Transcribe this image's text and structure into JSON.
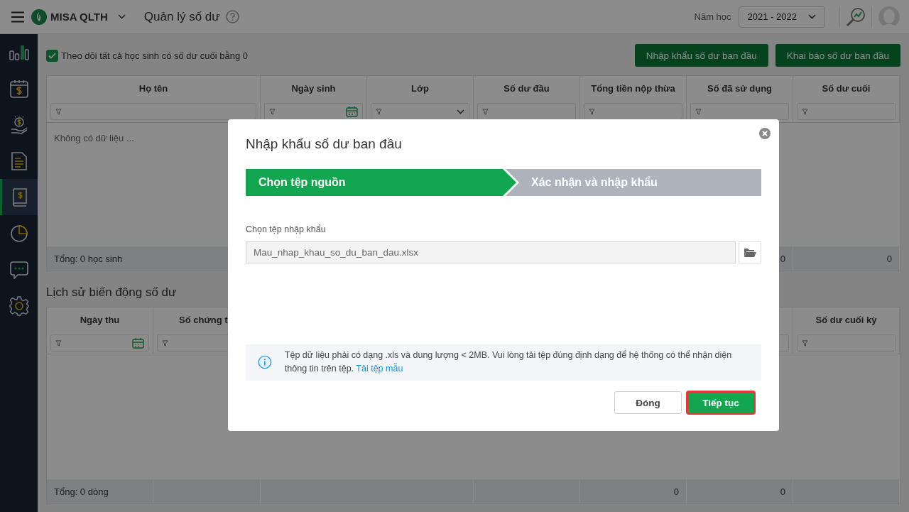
{
  "header": {
    "app_name": "MISA QLTH",
    "page_title": "Quản lý số dư",
    "year_label": "Năm học",
    "year_value": "2021 - 2022"
  },
  "sidebar": {
    "items": [
      {
        "kind": "chart",
        "selected": false
      },
      {
        "kind": "calendar",
        "selected": false
      },
      {
        "kind": "coin",
        "selected": false
      },
      {
        "kind": "document",
        "selected": false
      },
      {
        "kind": "book",
        "selected": true
      },
      {
        "kind": "pie",
        "selected": false
      },
      {
        "kind": "chat",
        "selected": false
      },
      {
        "kind": "gear",
        "selected": false
      }
    ]
  },
  "toolbar": {
    "checkbox": {
      "label": "Theo dõi tất cả học sinh có số dư cuối bằng 0",
      "checked": true
    },
    "buttons": [
      "Nhập khẩu số dư ban đầu",
      "Khai báo số dư ban đầu"
    ]
  },
  "balance_table": {
    "columns": [
      {
        "label": "Họ tên",
        "kind": "text"
      },
      {
        "label": "Ngày sinh",
        "kind": "date"
      },
      {
        "label": "Lớp",
        "kind": "select"
      },
      {
        "label": "Số dư đầu",
        "kind": "text"
      },
      {
        "label": "Tổng tiền nộp thừa",
        "kind": "text"
      },
      {
        "label": "Số đã sử dụng",
        "kind": "text",
        "total": "0"
      },
      {
        "label": "Số dư cuối",
        "kind": "text",
        "total": "0"
      }
    ],
    "empty_text": "Không có dữ liệu ...",
    "footer_label": "Tổng: 0 học sinh"
  },
  "history": {
    "title": "Lịch sử biến động số dư",
    "columns": [
      {
        "label": "Ngày thu",
        "kind": "date"
      },
      {
        "label": "Số chứng t",
        "kind": "text",
        "clipped": true
      },
      {},
      {},
      {
        "total": "0"
      },
      {
        "kind": "plain",
        "total": "0"
      },
      {
        "label": "Số dư cuối kỳ",
        "kind": "text"
      }
    ],
    "footer_label": "Tổng: 0 dòng"
  },
  "dialog": {
    "title": "Nhập khẩu số dư ban đầu",
    "steps": [
      {
        "label": "Chọn tệp nguồn",
        "selected": true
      },
      {
        "label": "Xác nhận và nhập khẩu",
        "selected": false
      }
    ],
    "file_label": "Chọn tệp nhập khẩu",
    "file_value": "Mau_nhap_khau_so_du_ban_dau.xlsx",
    "info_text": "Tệp dữ liệu phải có dạng .xls và dung lượng < 2MB. Vui lòng tải tệp đúng định dạng để hệ thống có thể nhận diện thông tin trên tệp.",
    "info_link": "Tải tệp mẫu",
    "buttons": [
      {
        "label": "Đóng",
        "kind": "secondary",
        "highlighted": false
      },
      {
        "label": "Tiếp tục",
        "kind": "primary",
        "highlighted": true
      }
    ]
  }
}
